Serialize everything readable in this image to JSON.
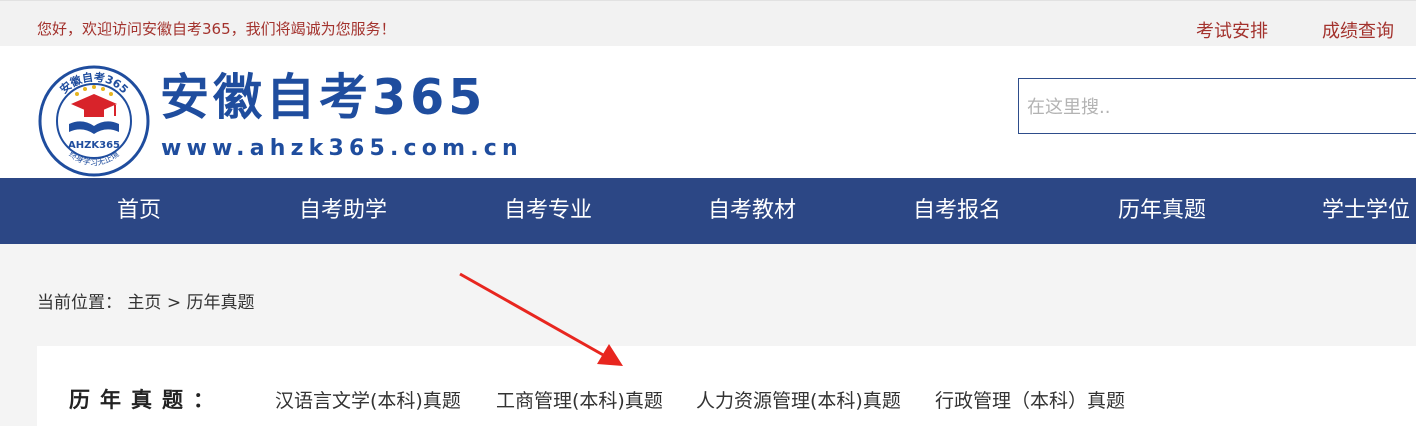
{
  "topbar": {
    "welcome": "您好，欢迎访问安徽自考365，我们将竭诚为您服务！",
    "links": [
      {
        "label": "考试安排"
      },
      {
        "label": "成绩查询"
      }
    ]
  },
  "header": {
    "logo": {
      "title": "安徽自考365",
      "url": "www.ahzk365.com.cn",
      "emblem_text": "AHZK365",
      "emblem_top": "安徽自考365",
      "emblem_bottom": "终身学习无止境"
    },
    "search": {
      "placeholder": "在这里搜.."
    }
  },
  "nav": {
    "items": [
      {
        "label": "首页"
      },
      {
        "label": "自考助学"
      },
      {
        "label": "自考专业"
      },
      {
        "label": "自考教材"
      },
      {
        "label": "自考报名"
      },
      {
        "label": "历年真题"
      },
      {
        "label": "学士学位"
      }
    ]
  },
  "breadcrumb": {
    "prefix": "当前位置：",
    "home": "主页",
    "sep": ">",
    "current": "历年真题"
  },
  "panel": {
    "label": "历年真题：",
    "links": [
      {
        "label": "汉语言文学(本科)真题"
      },
      {
        "label": "工商管理(本科)真题"
      },
      {
        "label": "人力资源管理(本科)真题"
      },
      {
        "label": "行政管理（本科）真题"
      }
    ]
  },
  "colors": {
    "accent_red": "#a3322d",
    "brand_blue": "#1f4d9e",
    "nav_bg": "#2c4785",
    "annotation_arrow": "#e8261f"
  }
}
